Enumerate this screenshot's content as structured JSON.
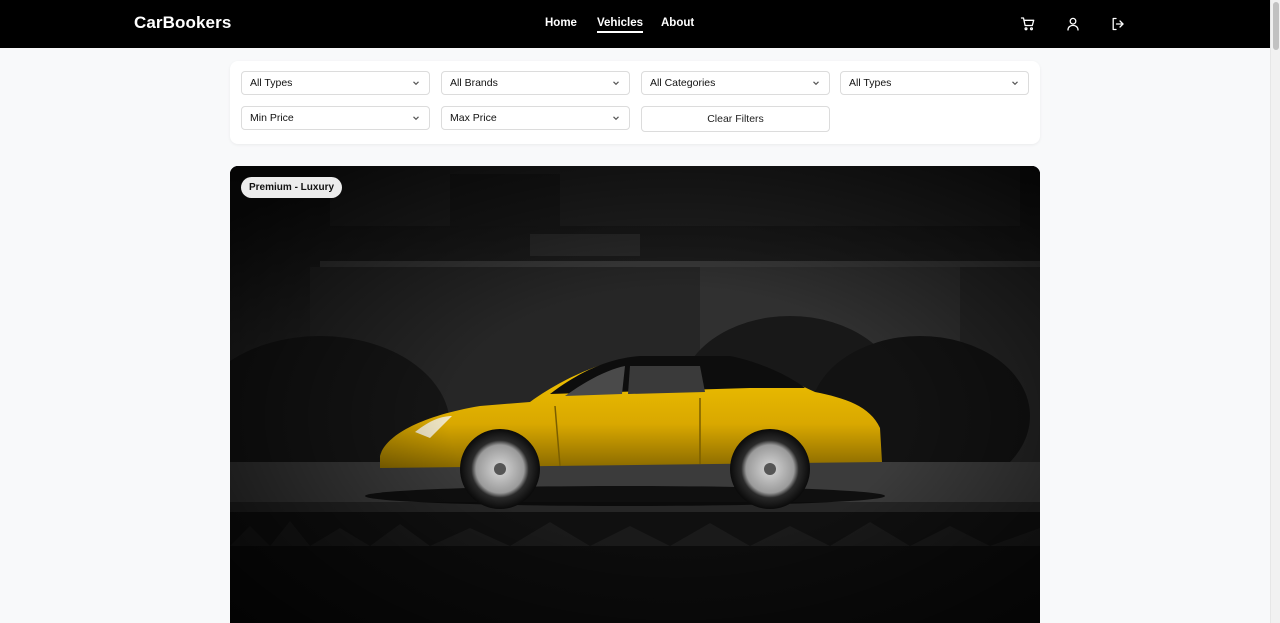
{
  "brand": "CarBookers",
  "nav": {
    "links": [
      {
        "label": "Home",
        "active": false
      },
      {
        "label": "Vehicles",
        "active": true
      },
      {
        "label": "About",
        "active": false
      }
    ],
    "icons": [
      "cart-icon",
      "user-icon",
      "logout-icon"
    ]
  },
  "filters": {
    "row1": [
      "All Types",
      "All Brands",
      "All Categories",
      "All Types"
    ],
    "row2": [
      "Min Price",
      "Max Price"
    ],
    "clear_label": "Clear Filters"
  },
  "vehicle": {
    "badge": "Premium - Luxury",
    "image": "yellow-convertible-sports-car-photo"
  },
  "colors": {
    "navbar_bg": "#000000",
    "page_bg": "#f8f9fa",
    "car_yellow": "#e8b800"
  }
}
